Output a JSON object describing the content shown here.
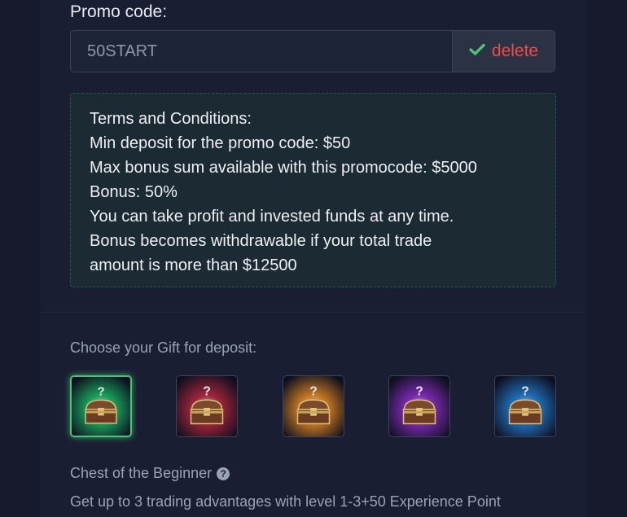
{
  "promo": {
    "label": "Promo code:",
    "value": "50START",
    "delete_label": "delete",
    "check_color": "#4ec07a",
    "delete_color": "#ef4b4b"
  },
  "terms": {
    "lines": [
      "Terms and Conditions:",
      "Min deposit for the promo code: $50",
      "Max bonus sum available with this promocode: $5000",
      "Bonus: 50%",
      "You can take profit and invested funds at any time.",
      "Bonus becomes withdrawable if your total trade",
      "amount is more than $12500"
    ]
  },
  "gifts": {
    "title": "Choose your Gift for deposit:",
    "chests": [
      {
        "icon": "green-chest-icon",
        "color": "#19a35c",
        "selected": true
      },
      {
        "icon": "red-chest-icon",
        "color": "#a3243a",
        "selected": false
      },
      {
        "icon": "orange-chest-icon",
        "color": "#c97a22",
        "selected": false
      },
      {
        "icon": "purple-chest-icon",
        "color": "#7a2ab0",
        "selected": false
      },
      {
        "icon": "blue-chest-icon",
        "color": "#1f6fb8",
        "selected": false
      }
    ],
    "selected_name": "Chest of the Beginner",
    "help_glyph": "?",
    "description": "Get up to 3 trading advantages with level 1-3+50 Experience Point"
  }
}
